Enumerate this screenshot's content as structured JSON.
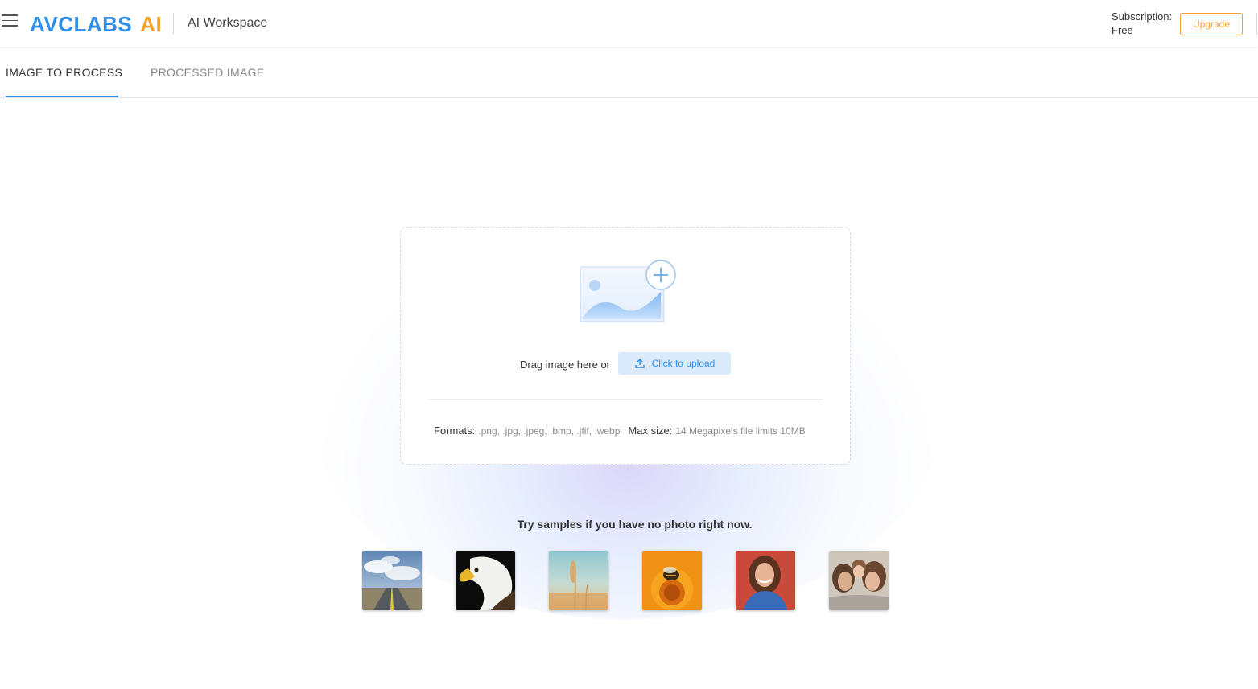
{
  "header": {
    "menu_icon": "hamburger-menu-icon",
    "logo_brand": "AVCLABS",
    "logo_ai": "AI",
    "workspace_title": "AI Workspace",
    "subscription_label": "Subscription:",
    "subscription_plan": "Free",
    "upgrade_label": "Upgrade",
    "accent_color": "#2f8ee6",
    "brand_orange": "#f0a12f"
  },
  "tabs": [
    {
      "label": "IMAGE TO PROCESS",
      "active": true
    },
    {
      "label": "PROCESSED IMAGE",
      "active": false
    }
  ],
  "upload": {
    "illustration_icon": "image-add-icon",
    "drag_text": "Drag image here or",
    "upload_icon": "upload-icon",
    "upload_label": "Click to upload",
    "formats_label": "Formats:",
    "formats_value": ".png, .jpg, .jpeg, .bmp, .jfif, .webp",
    "maxsize_label": "Max size:",
    "maxsize_value": "14 Megapixels file limits 10MB"
  },
  "samples": {
    "title": "Try samples if you have no photo right now.",
    "items": [
      {
        "name": "road"
      },
      {
        "name": "eagle"
      },
      {
        "name": "wheat"
      },
      {
        "name": "bee-flower"
      },
      {
        "name": "woman-portrait"
      },
      {
        "name": "family"
      }
    ]
  }
}
